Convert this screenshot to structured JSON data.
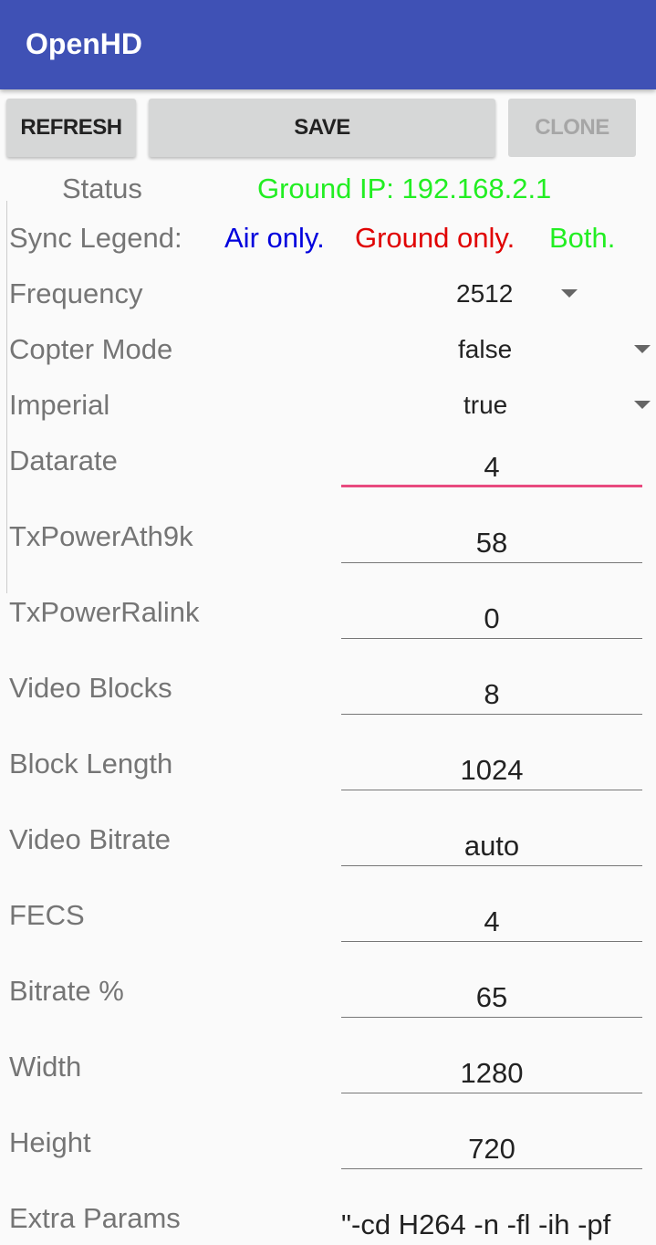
{
  "app": {
    "title": "OpenHD"
  },
  "toolbar": {
    "refresh": "REFRESH",
    "save": "SAVE",
    "clone": "CLONE"
  },
  "status": {
    "label": "Status",
    "value": "Ground IP: 192.168.2.1"
  },
  "legend": {
    "label": "Sync Legend:",
    "air": "Air only.",
    "ground": "Ground only.",
    "both": "Both.",
    "colors": {
      "air": "#0000dd",
      "ground": "#e00000",
      "both": "#22ee22"
    }
  },
  "spinners": [
    {
      "label": "Frequency",
      "value": "2512"
    },
    {
      "label": "Copter Mode",
      "value": "false"
    },
    {
      "label": "Imperial",
      "value": "true"
    }
  ],
  "fields": [
    {
      "label": "Datarate",
      "value": "4"
    },
    {
      "label": "TxPowerAth9k",
      "value": "58"
    },
    {
      "label": "TxPowerRalink",
      "value": "0"
    },
    {
      "label": "Video Blocks",
      "value": "8"
    },
    {
      "label": "Block Length",
      "value": "1024"
    },
    {
      "label": "Video Bitrate",
      "value": "auto"
    },
    {
      "label": "FECS",
      "value": "4"
    },
    {
      "label": "Bitrate %",
      "value": "65"
    },
    {
      "label": "Width",
      "value": "1280"
    },
    {
      "label": "Height",
      "value": "720"
    },
    {
      "label": "Extra Params",
      "value": "\"-cd H264 -n -fl -ih -pf"
    }
  ]
}
